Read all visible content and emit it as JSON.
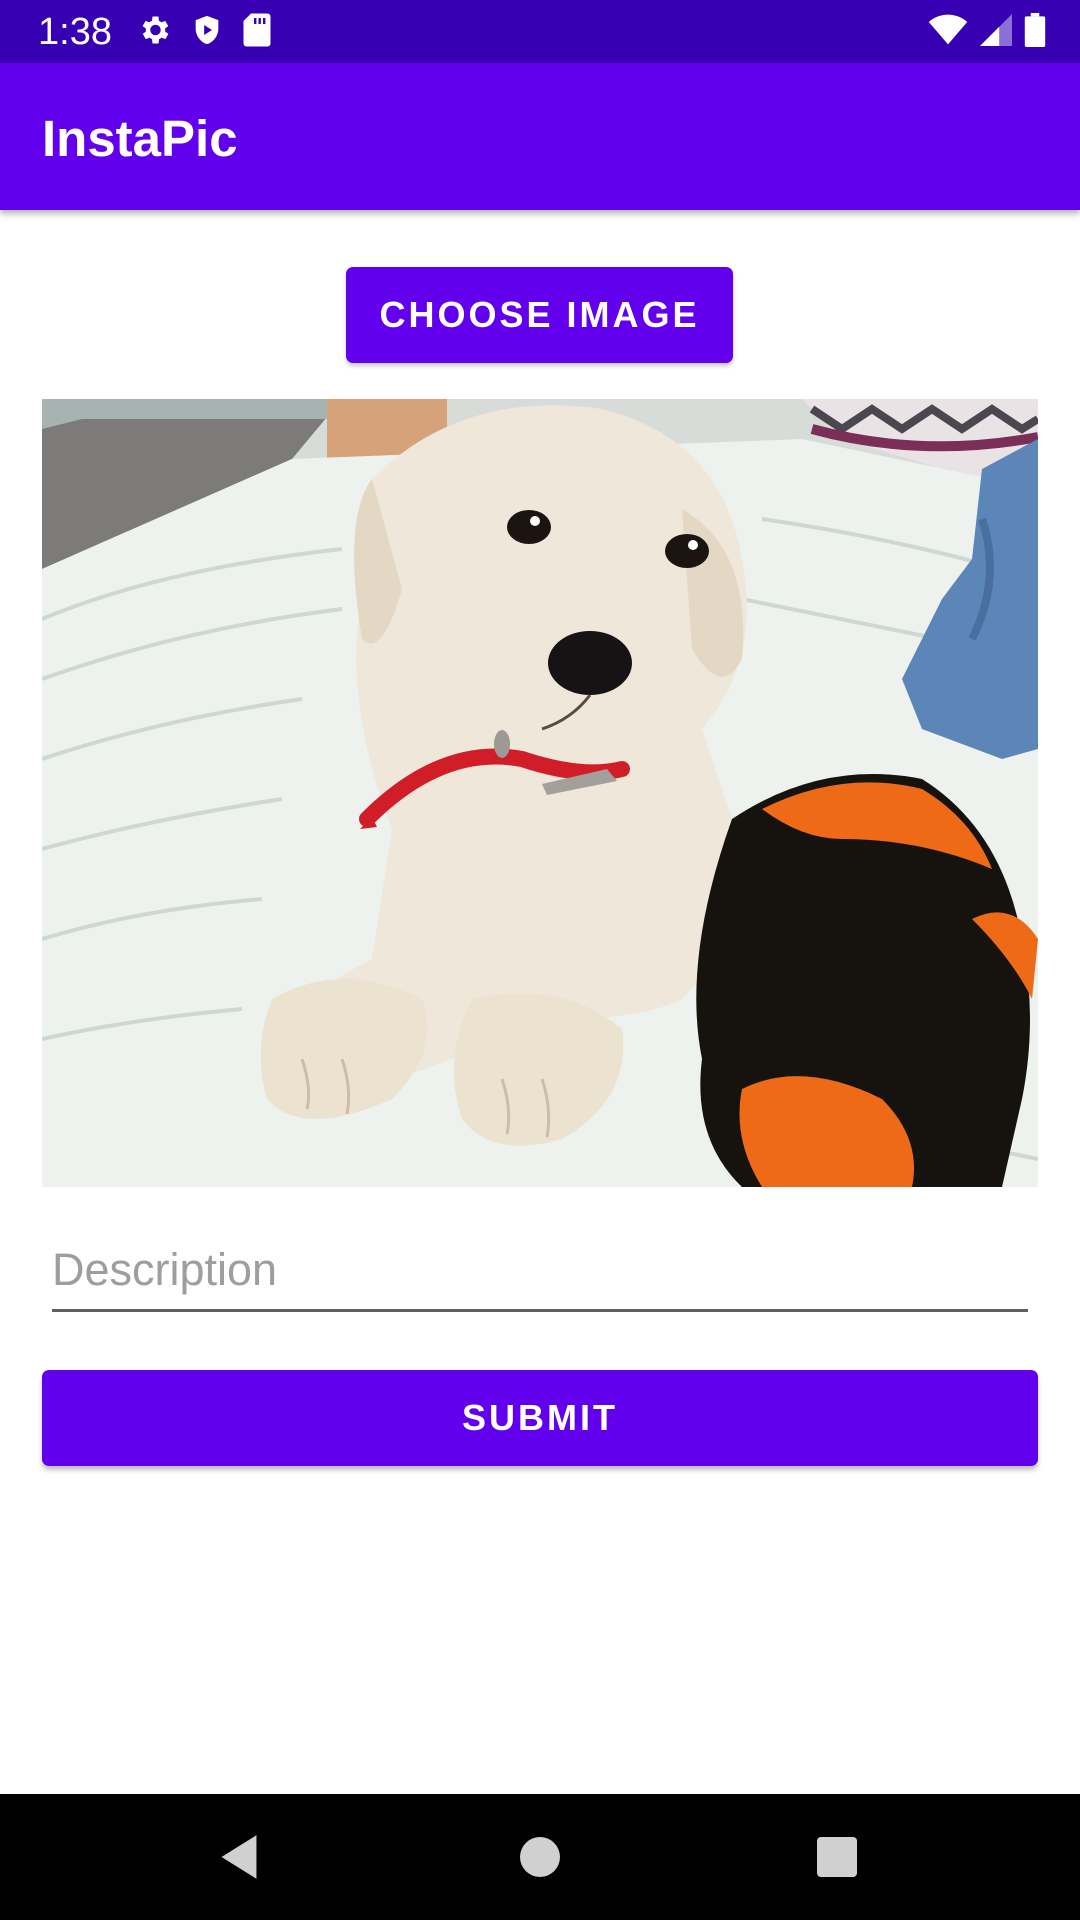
{
  "status_bar": {
    "time": "1:38",
    "left_icons": [
      "settings-icon",
      "shield-icon",
      "sd-card-icon"
    ],
    "right_icons": [
      "wifi-icon",
      "cell-signal-icon",
      "battery-icon"
    ],
    "background_color": "#3700b3"
  },
  "app_bar": {
    "title": "InstaPic",
    "background_color": "#6200ee"
  },
  "main": {
    "choose_image_label": "CHOOSE IMAGE",
    "photo_subject": "puppy-photo",
    "description": {
      "value": "",
      "placeholder": "Description"
    },
    "submit_label": "SUBMIT"
  },
  "nav_bar": {
    "buttons": [
      "back-icon",
      "home-icon",
      "recents-icon"
    ]
  },
  "colors": {
    "primary": "#6200ee",
    "primary_dark": "#3700b3",
    "placeholder": "#9e9e9e"
  }
}
